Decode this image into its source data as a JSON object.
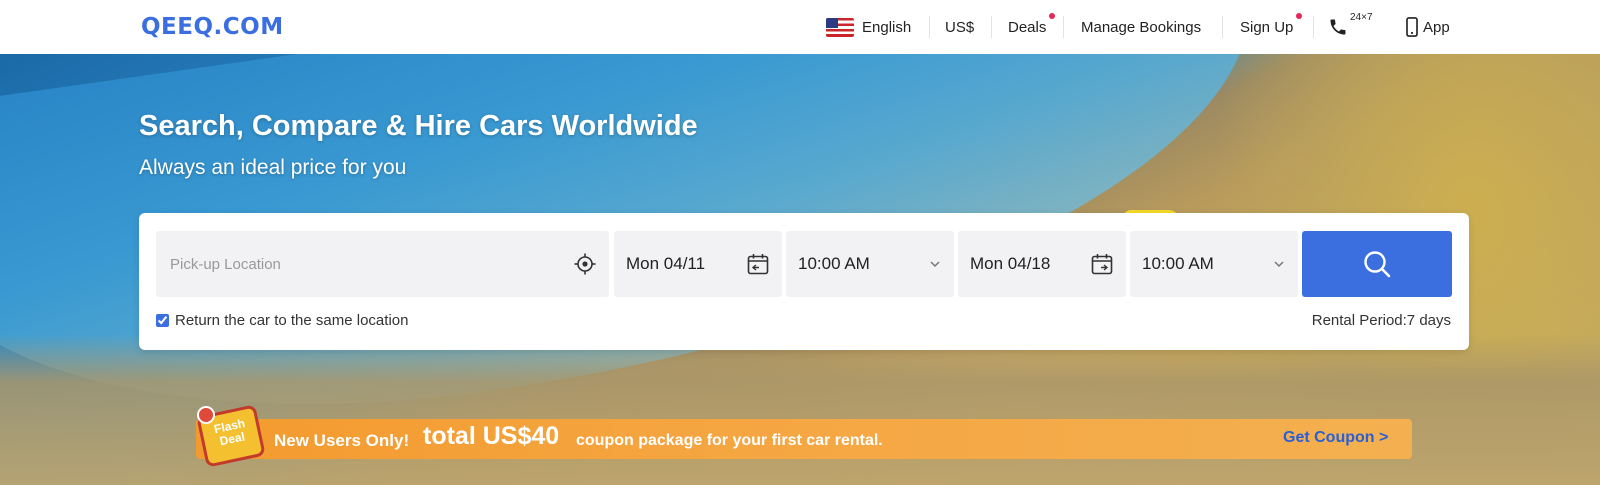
{
  "brand": {
    "logo_text": "QEEQ.COM"
  },
  "nav": {
    "language": "English",
    "currency": "US$",
    "deals": "Deals",
    "manage_bookings": "Manage Bookings",
    "sign_up": "Sign Up",
    "support_hours": "24×7",
    "app": "App",
    "flag_icon": "us-flag-icon",
    "phone_icon": "phone-icon",
    "mobile_icon": "mobile-icon"
  },
  "hero": {
    "title": "Search, Compare & Hire Cars Worldwide",
    "subtitle": "Always an ideal price for you"
  },
  "search": {
    "location_placeholder": "Pick-up Location",
    "pickup_date": "Mon 04/11",
    "pickup_time": "10:00 AM",
    "dropoff_date": "Mon 04/18",
    "dropoff_time": "10:00 AM",
    "return_same_location_label": "Return the car to the same location",
    "return_same_location_checked": true,
    "rental_period": "Rental Period:7 days"
  },
  "promo": {
    "badge": "Flash Deal",
    "lead": "New Users Only!",
    "amount": "total US$40",
    "tail": "coupon package for your first car rental.",
    "link": "Get Coupon >"
  },
  "colors": {
    "brand_blue": "#3b6fe0",
    "dot_red": "#e8265a",
    "promo_orange": "#f5a540"
  }
}
